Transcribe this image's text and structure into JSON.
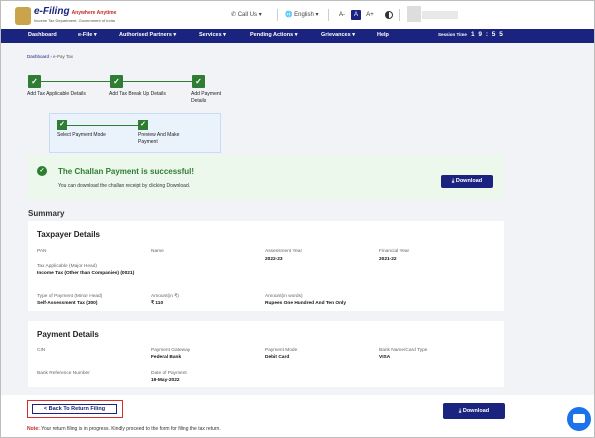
{
  "header": {
    "logo_title": "e-Filing",
    "logo_sub": "Anywhere Anytime",
    "logo_tag": "Income Tax Department, Government of India",
    "call_us": "Call Us",
    "language": "English",
    "font_small": "A-",
    "font_normal": "A",
    "font_large": "A+"
  },
  "nav": {
    "items": [
      "Dashboard",
      "e-File",
      "Authorised Partners",
      "Services",
      "Pending Actions",
      "Grievances",
      "Help"
    ],
    "session_label": "Session Time",
    "session_time": "1 9 : 5 5"
  },
  "breadcrumb": {
    "root": "Dashboard",
    "current": "e-Pay Tax"
  },
  "stepper": {
    "steps": [
      "Add Tax Applicable Details",
      "Add Tax Break Up Details",
      "Add Payment Details"
    ],
    "substeps": [
      "Select Payment Mode",
      "Preview And Make Payment"
    ]
  },
  "success": {
    "title": "The Challan Payment is successful!",
    "subtitle": "You can download the challan receipt by clicking Download.",
    "download_label": "Download"
  },
  "summary_title": "Summary",
  "taxpayer": {
    "title": "Taxpayer Details",
    "pan_label": "PAN",
    "name_label": "Name",
    "ay_label": "Assessment Year",
    "ay_value": "2022-23",
    "fy_label": "Financial Year",
    "fy_value": "2021-22",
    "major_label": "Tax Applicable (Major Head)",
    "major_value": "Income Tax (Other than Companies) (0021)",
    "minor_label": "Type of Payment (Minor Head)",
    "minor_value": "Self-Assessment Tax (300)",
    "amount_label": "Amount(in ₹)",
    "amount_value": "₹ 110",
    "words_label": "Amount(in words)",
    "words_value": "Rupees One Hundred And Ten Only"
  },
  "payment": {
    "title": "Payment Details",
    "cin_label": "CIN",
    "gateway_label": "Payment Gateway",
    "gateway_value": "Federal Bank",
    "mode_label": "Payment Mode",
    "mode_value": "Debit Card",
    "bank_label": "Bank Name/Card Type",
    "bank_value": "VISA",
    "ref_label": "Bank Reference Number",
    "date_label": "Date of Payment",
    "date_value": "19-May-2022"
  },
  "footer": {
    "back_label": "< Back To Return Filing",
    "download_label": "Download",
    "note_prefix": "Note:",
    "note_text": "Your return filing is in progress. Kindly proceed to the form for filing the tax return."
  }
}
